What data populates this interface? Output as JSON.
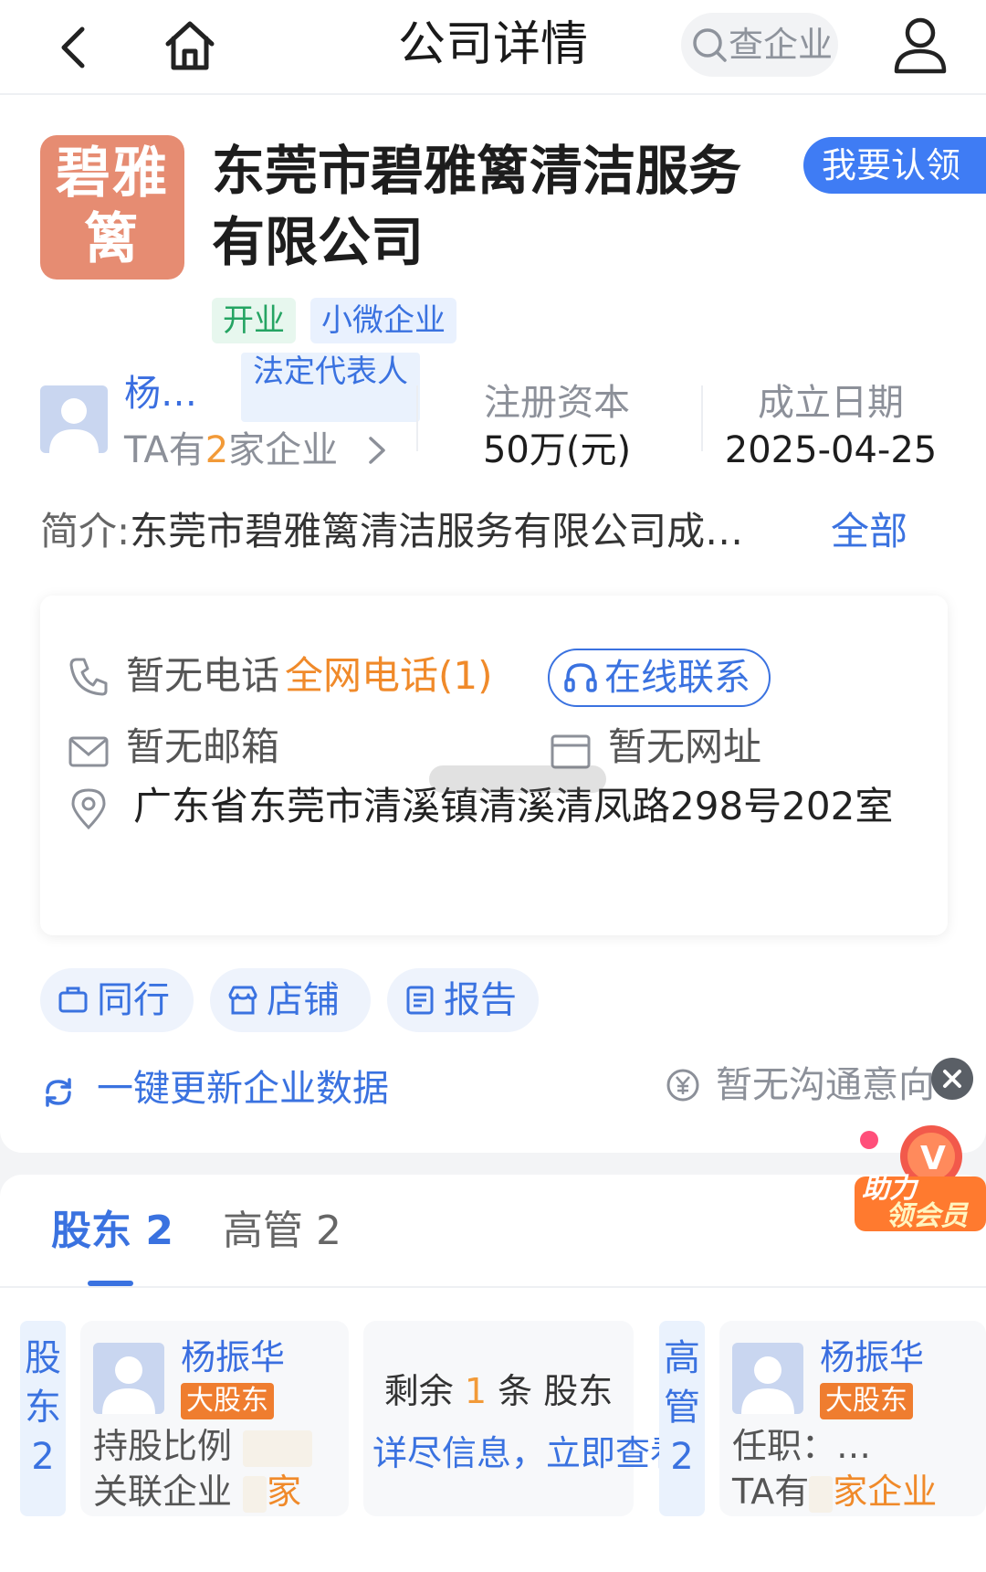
{
  "nav": {
    "title": "公司详情",
    "search_placeholder": "查企业"
  },
  "company": {
    "logo_text": "碧雅篱",
    "name": "东莞市碧雅篱清洁服务有限公司",
    "claim_label": "我要认领",
    "tags": [
      "开业",
      "小微企业"
    ]
  },
  "representative": {
    "name": "杨…",
    "role": "法定代表人",
    "count_prefix": "TA有",
    "count": "2",
    "count_suffix": "家企业"
  },
  "stats": {
    "capital_label": "注册资本",
    "capital_value": "50万(元)",
    "date_label": "成立日期",
    "date_value": "2025-04-25"
  },
  "intro": {
    "label": "简介:",
    "text": "东莞市碧雅篱清洁服务有限公司成…",
    "more_label": "全部"
  },
  "contact": {
    "phone": "暂无电话",
    "all_phone": "全网电话(1)",
    "online_label": "在线联系",
    "email": "暂无邮箱",
    "website": "暂无网址",
    "address": "广东省东莞市清溪镇清溪清凤路298号202室"
  },
  "actions": {
    "peers": "同行",
    "shops": "店铺",
    "report": "报告",
    "refresh": "一键更新企业数据",
    "intent": "暂无沟通意向"
  },
  "promo": {
    "line1": "助力",
    "line2": "领会员"
  },
  "tabs": {
    "shareholders": "股东 2",
    "executives": "高管 2"
  },
  "shareholders": {
    "side_label": [
      "股",
      "东",
      "2"
    ],
    "person_name": "杨振华",
    "person_tag": "大股东",
    "ratio_label": "持股比例",
    "related_label": "关联企业",
    "related_suffix": "家",
    "more_line1_prefix": "剩余",
    "more_count": "1",
    "more_line1_suffix": "条 股东",
    "more_line2": "详尽信息，立即查看"
  },
  "executives": {
    "side_label": [
      "高",
      "管",
      "2"
    ],
    "person_name": "杨振华",
    "person_tag": "大股东",
    "position_label": "任职：…",
    "count_prefix": "TA有",
    "count_suffix": "家企业"
  },
  "colors": {
    "accent": "#3a72e0",
    "logo_bg": "#e68c72",
    "orange": "#f08a2a",
    "green": "#25a463"
  }
}
